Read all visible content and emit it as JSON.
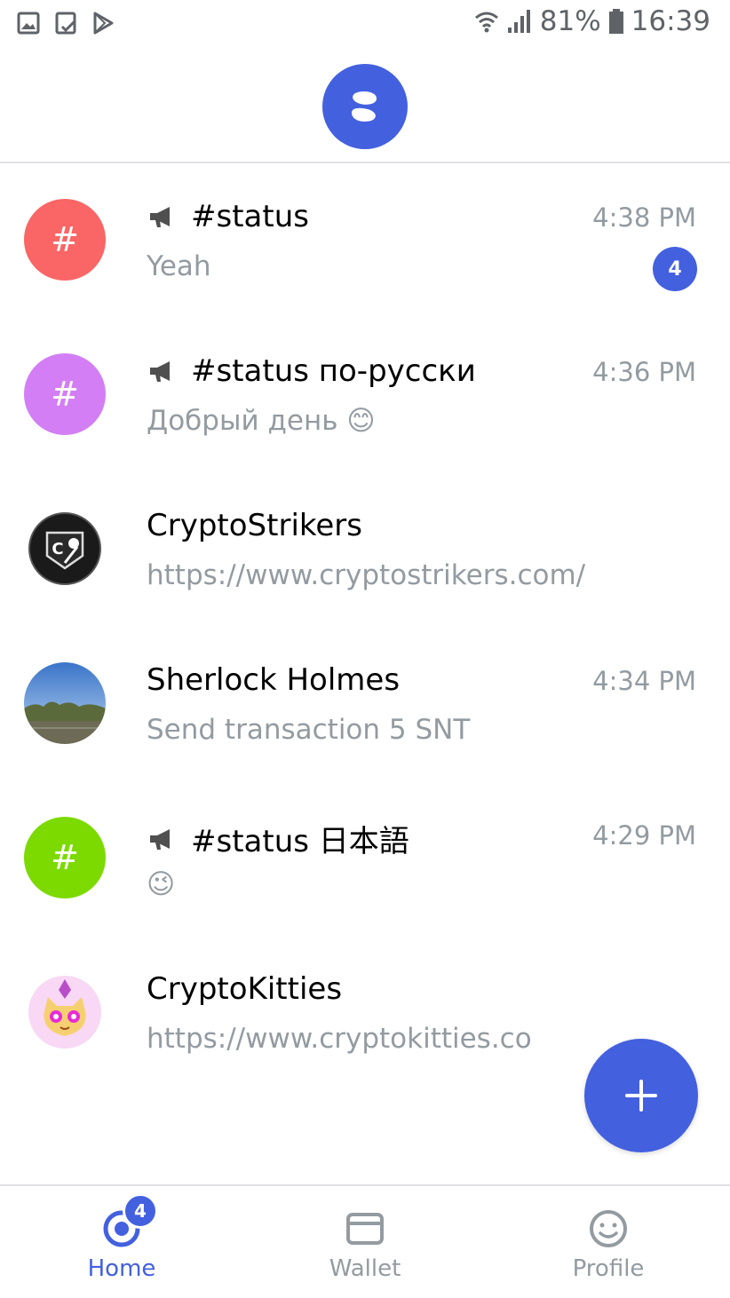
{
  "status_bar": {
    "battery": "81%",
    "time": "16:39",
    "icons": [
      "gallery-icon",
      "clipboard-check-icon",
      "play-store-icon",
      "wifi-icon",
      "signal-icon",
      "battery-icon"
    ]
  },
  "header": {
    "logo": "status-logo-icon"
  },
  "colors": {
    "accent": "#4360df",
    "muted_text": "#939ba1",
    "avatar_red": "#fa6565",
    "avatar_purple": "#d37ef4",
    "avatar_green": "#7cda00"
  },
  "chats": [
    {
      "name": "#status",
      "preview": "Yeah",
      "time": "4:38 PM",
      "unread": "4",
      "type": "public",
      "avatar": "#"
    },
    {
      "name": "#status по-русски",
      "preview": "Добрый день 😊",
      "time": "4:36 PM",
      "unread": "",
      "type": "public",
      "avatar": "#"
    },
    {
      "name": "CryptoStrikers",
      "preview": "https://www.cryptostrikers.com/",
      "time": "",
      "unread": "",
      "type": "dapp",
      "avatar": "C"
    },
    {
      "name": "Sherlock Holmes",
      "preview": "Send transaction 5 SNT",
      "time": "4:34 PM",
      "unread": "",
      "type": "contact",
      "avatar": ""
    },
    {
      "name": "#status 日本語",
      "preview": "😉",
      "time": "4:29 PM",
      "unread": "",
      "type": "public",
      "avatar": "#"
    },
    {
      "name": "CryptoKitties",
      "preview": "https://www.cryptokitties.co",
      "time": "",
      "unread": "",
      "type": "dapp",
      "avatar": ""
    }
  ],
  "fab": {
    "icon": "plus-icon"
  },
  "bottom_nav": {
    "items": [
      {
        "label": "Home",
        "icon": "home-icon",
        "badge": "4",
        "active": true
      },
      {
        "label": "Wallet",
        "icon": "wallet-icon",
        "badge": "",
        "active": false
      },
      {
        "label": "Profile",
        "icon": "profile-icon",
        "badge": "",
        "active": false
      }
    ]
  }
}
